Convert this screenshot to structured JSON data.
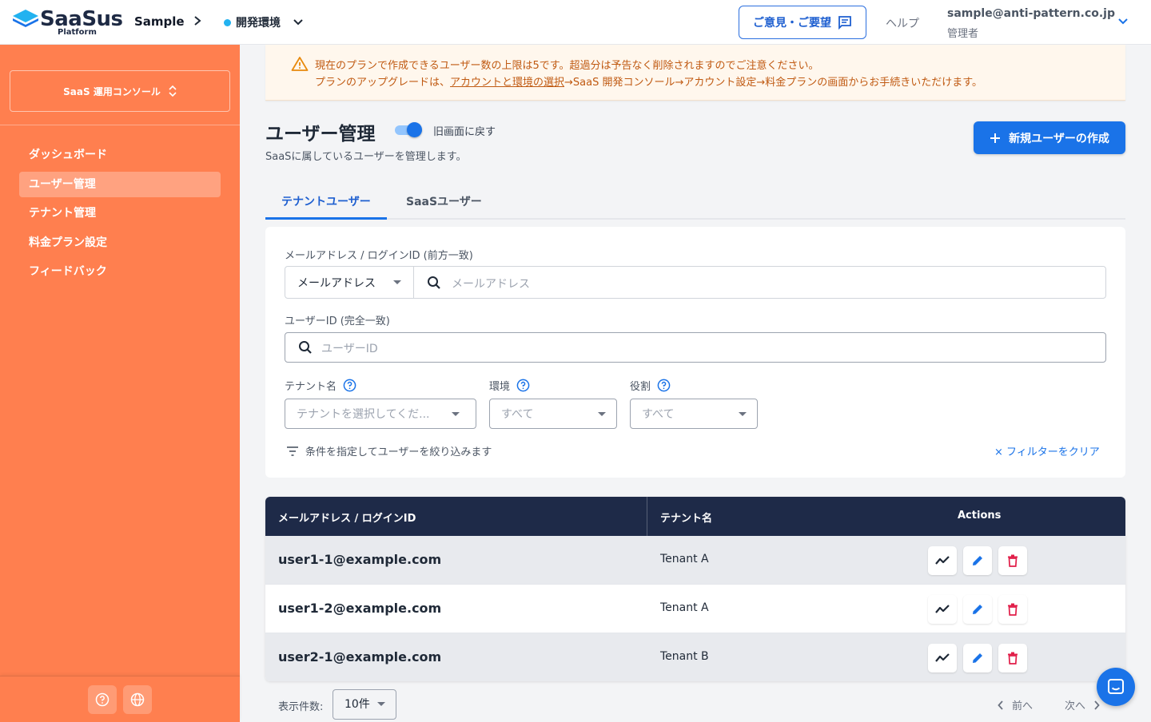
{
  "header": {
    "logo_text": "SaaSus",
    "logo_sub": "Platform",
    "app_name": "Sample",
    "env_name": "開発環境",
    "feedback_label": "ご意見・ご要望",
    "help_label": "ヘルプ",
    "user_email": "sample@anti-pattern.co.jp",
    "user_role": "管理者"
  },
  "sidebar": {
    "console_label": "SaaS 運用コンソール",
    "items": [
      {
        "label": "ダッシュボード"
      },
      {
        "label": "ユーザー管理"
      },
      {
        "label": "テナント管理"
      },
      {
        "label": "料金プラン設定"
      },
      {
        "label": "フィードバック"
      }
    ],
    "active_index": 1
  },
  "alert": {
    "line1": "現在のプランで作成できるユーザー数の上限は5です。超過分は予告なく削除されますのでご注意ください。",
    "line2_prefix": "プランのアップグレードは、",
    "line2_link": "アカウントと環境の選択",
    "line2_suffix": "→SaaS 開発コンソール→アカウント設定→料金プランの画面からお手続きいただけます。"
  },
  "page": {
    "title": "ユーザー管理",
    "toggle_label": "旧画面に戻す",
    "description": "SaaSに属しているユーザーを管理します。",
    "create_button": "新規ユーザーの作成"
  },
  "tabs": [
    {
      "label": "テナントユーザー",
      "active": true
    },
    {
      "label": "SaaSユーザー",
      "active": false
    }
  ],
  "filters": {
    "email_label": "メールアドレス / ログインID (前方一致)",
    "email_type": "メールアドレス",
    "email_placeholder": "メールアドレス",
    "userid_label": "ユーザーID (完全一致)",
    "userid_placeholder": "ユーザーID",
    "tenant_label": "テナント名",
    "tenant_placeholder": "テナントを選択してくだ...",
    "env_label": "環境",
    "env_value": "すべて",
    "role_label": "役割",
    "role_value": "すべて",
    "hint": "条件を指定してユーザーを絞り込みます",
    "clear": "× フィルターをクリア"
  },
  "table": {
    "columns": [
      "メールアドレス / ログインID",
      "テナント名",
      "Actions"
    ],
    "rows": [
      {
        "email": "user1-1@example.com",
        "tenant": "Tenant A"
      },
      {
        "email": "user1-2@example.com",
        "tenant": "Tenant A"
      },
      {
        "email": "user2-1@example.com",
        "tenant": "Tenant B"
      }
    ]
  },
  "pagination": {
    "per_page_label": "表示件数:",
    "per_page_value": "10件",
    "prev": "前へ",
    "next": "次へ"
  },
  "colors": {
    "sidebar": "#ff7f4f",
    "primary": "#1a73e8",
    "table_header": "#1e2a48",
    "alert_bg": "#fff7ed",
    "alert_text": "#c05a12",
    "delete": "#e11d48"
  },
  "icons": [
    "chevron-right-icon",
    "chevron-down-icon",
    "comment-icon",
    "unfold-icon",
    "help-circle-icon",
    "globe-icon",
    "warning-icon",
    "plus-icon",
    "search-icon",
    "filter-icon",
    "analytics-icon",
    "edit-icon",
    "trash-icon",
    "chat-icon"
  ]
}
